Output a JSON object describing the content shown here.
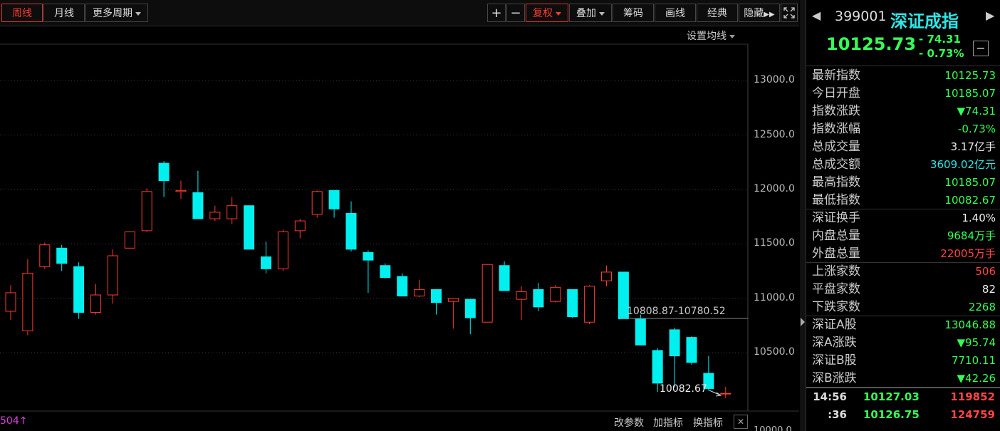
{
  "toolbar": {
    "period_tabs": [
      "周线",
      "月线"
    ],
    "more_periods": "更多周期",
    "zoom_in": "+",
    "zoom_out": "−",
    "restore_rights": "复权",
    "overlay": "叠加",
    "chips": "筹码",
    "draw": "画线",
    "classic": "经典",
    "hide": "隐藏",
    "ma_settings": "设置均线"
  },
  "chart": {
    "y_ticks": [
      "13000.0",
      "12500.0",
      "12000.0",
      "11500.0",
      "11000.0",
      "10500.0",
      "10000.0"
    ],
    "range_label": "10808.87-10780.52",
    "low_label": "10082.67",
    "left_marker": "504↑",
    "bottom_tools": [
      "改参数",
      "加指标",
      "换指标"
    ],
    "close_x": "✕"
  },
  "chart_data": {
    "type": "candlestick",
    "ylim": [
      10050,
      13250
    ],
    "candles": [
      {
        "o": 10880,
        "c": 11050,
        "h": 11120,
        "l": 10800
      },
      {
        "o": 10700,
        "c": 11230,
        "h": 11360,
        "l": 10660
      },
      {
        "o": 11290,
        "c": 11490,
        "h": 11510,
        "l": 11270
      },
      {
        "o": 11460,
        "c": 11320,
        "h": 11490,
        "l": 11250
      },
      {
        "o": 11290,
        "c": 10870,
        "h": 11330,
        "l": 10810
      },
      {
        "o": 10870,
        "c": 11030,
        "h": 11130,
        "l": 10850
      },
      {
        "o": 11030,
        "c": 11390,
        "h": 11450,
        "l": 10950
      },
      {
        "o": 11460,
        "c": 11610,
        "h": 11610,
        "l": 11460
      },
      {
        "o": 11620,
        "c": 11980,
        "h": 12010,
        "l": 11610
      },
      {
        "o": 12240,
        "c": 12080,
        "h": 12260,
        "l": 11930
      },
      {
        "o": 11980,
        "c": 11990,
        "h": 12080,
        "l": 11910
      },
      {
        "o": 11970,
        "c": 11730,
        "h": 12170,
        "l": 11730
      },
      {
        "o": 11730,
        "c": 11790,
        "h": 11850,
        "l": 11710
      },
      {
        "o": 11730,
        "c": 11850,
        "h": 11930,
        "l": 11680
      },
      {
        "o": 11850,
        "c": 11450,
        "h": 11850,
        "l": 11450
      },
      {
        "o": 11380,
        "c": 11270,
        "h": 11520,
        "l": 11230
      },
      {
        "o": 11270,
        "c": 11610,
        "h": 11630,
        "l": 11250
      },
      {
        "o": 11620,
        "c": 11710,
        "h": 11730,
        "l": 11550
      },
      {
        "o": 11770,
        "c": 11980,
        "h": 11990,
        "l": 11740
      },
      {
        "o": 11990,
        "c": 11820,
        "h": 11990,
        "l": 11740
      },
      {
        "o": 11780,
        "c": 11450,
        "h": 11890,
        "l": 11430
      },
      {
        "o": 11420,
        "c": 11350,
        "h": 11440,
        "l": 11050
      },
      {
        "o": 11300,
        "c": 11190,
        "h": 11320,
        "l": 11180
      },
      {
        "o": 11200,
        "c": 11020,
        "h": 11230,
        "l": 11020
      },
      {
        "o": 11020,
        "c": 11080,
        "h": 11170,
        "l": 11010
      },
      {
        "o": 11080,
        "c": 10960,
        "h": 11080,
        "l": 10850
      },
      {
        "o": 10970,
        "c": 11000,
        "h": 11000,
        "l": 10720
      },
      {
        "o": 10990,
        "c": 10820,
        "h": 10990,
        "l": 10670
      },
      {
        "o": 10780,
        "c": 11310,
        "h": 11310,
        "l": 10780
      },
      {
        "o": 11300,
        "c": 11070,
        "h": 11340,
        "l": 11070
      },
      {
        "o": 10990,
        "c": 11060,
        "h": 11110,
        "l": 10800
      },
      {
        "o": 11080,
        "c": 10920,
        "h": 11140,
        "l": 10880
      },
      {
        "o": 10970,
        "c": 11100,
        "h": 11120,
        "l": 10960
      },
      {
        "o": 11080,
        "c": 10830,
        "h": 11080,
        "l": 10820
      },
      {
        "o": 10780,
        "c": 11110,
        "h": 11120,
        "l": 10760
      },
      {
        "o": 11160,
        "c": 11240,
        "h": 11300,
        "l": 11110
      },
      {
        "o": 11240,
        "c": 10810,
        "h": 11240,
        "l": 10810
      },
      {
        "o": 10810,
        "c": 10570,
        "h": 10850,
        "l": 10570
      },
      {
        "o": 10520,
        "c": 10220,
        "h": 10540,
        "l": 10140
      },
      {
        "o": 10710,
        "c": 10470,
        "h": 10730,
        "l": 10180
      },
      {
        "o": 10640,
        "c": 10410,
        "h": 10650,
        "l": 10390
      },
      {
        "o": 10310,
        "c": 10170,
        "h": 10470,
        "l": 10150
      },
      {
        "o": 10126,
        "c": 10126,
        "h": 10185,
        "l": 10083
      }
    ]
  },
  "quote": {
    "code": "399001",
    "name": "深证成指",
    "price": "10125.73",
    "change": "- 74.31",
    "change_pct": "- 0.73%",
    "collapse": "−",
    "prev": "◀",
    "next": "▶"
  },
  "stats1": [
    {
      "label": "最新指数",
      "value": "10125.73",
      "color": "green"
    },
    {
      "label": "今日开盘",
      "value": "10185.07",
      "color": "green"
    },
    {
      "label": "指数涨跌",
      "value": "▼74.31",
      "color": "green"
    },
    {
      "label": "指数涨幅",
      "value": "-0.73%",
      "color": "green"
    },
    {
      "label": "总成交量",
      "value": "3.17亿手",
      "color": "white"
    },
    {
      "label": "总成交额",
      "value": "3609.02亿元",
      "color": "cyan"
    },
    {
      "label": "最高指数",
      "value": "10185.07",
      "color": "green"
    },
    {
      "label": "最低指数",
      "value": "10082.67",
      "color": "green"
    }
  ],
  "stats2": [
    {
      "label": "深证换手",
      "value": "1.40%",
      "color": "white"
    },
    {
      "label": "内盘总量",
      "value": "9684万手",
      "color": "green"
    },
    {
      "label": "外盘总量",
      "value": "22005万手",
      "color": "red"
    }
  ],
  "stats3": [
    {
      "label": "上涨家数",
      "value": "506",
      "color": "red"
    },
    {
      "label": "平盘家数",
      "value": "82",
      "color": "white"
    },
    {
      "label": "下跌家数",
      "value": "2268",
      "color": "green"
    }
  ],
  "stats4": [
    {
      "label": "深证A股",
      "value": "13046.88",
      "color": "green"
    },
    {
      "label": "深A涨跌",
      "value": "▼95.74",
      "color": "green"
    },
    {
      "label": "深证B股",
      "value": "7710.11",
      "color": "green"
    },
    {
      "label": "深B涨跌",
      "value": "▼42.26",
      "color": "green"
    }
  ],
  "ticks": [
    {
      "time": "14:56",
      "price": "10127.03",
      "vol": "119852"
    },
    {
      "time": ":36",
      "price": "10126.75",
      "vol": "124759"
    }
  ],
  "colors": {
    "up": "#ff3b30",
    "down": "#00f0f0",
    "accent": "#2ee6e6"
  }
}
